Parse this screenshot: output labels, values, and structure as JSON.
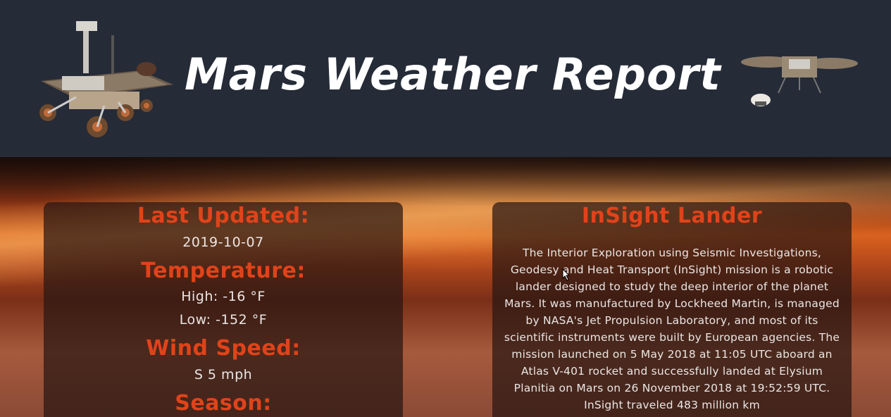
{
  "header": {
    "title": "Mars Weather Report",
    "rover_image": "rover-image",
    "lander_image": "lander-image"
  },
  "weather": {
    "last_updated_label": "Last Updated:",
    "last_updated_value": "2019-10-07",
    "temperature_label": "Temperature:",
    "high": "High: -16 °F",
    "low": "Low: -152 °F",
    "wind_label": "Wind Speed:",
    "wind_value": "S 5 mph",
    "season_label": "Season:"
  },
  "insight": {
    "title": "InSight Lander",
    "description": "The Interior Exploration using Seismic Investigations, Geodesy and Heat Transport (InSight) mission is a robotic lander designed to study the deep interior of the planet Mars. It was manufactured by Lockheed Martin, is managed by NASA's Jet Propulsion Laboratory, and most of its scientific instruments were built by European agencies. The mission launched on 5 May 2018 at 11:05 UTC aboard an Atlas V-401 rocket and successfully landed at Elysium Planitia on Mars on 26 November 2018 at 19:52:59 UTC. InSight traveled 483 million km"
  },
  "colors": {
    "header_bg": "#252b37",
    "heading": "#e0431a",
    "text": "#eae6e4"
  }
}
